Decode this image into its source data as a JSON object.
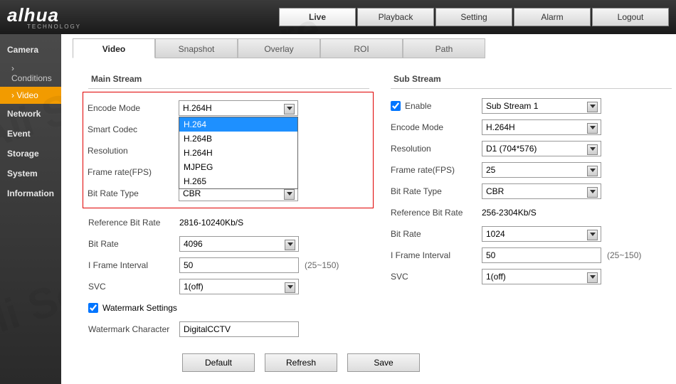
{
  "logo": "alhua",
  "logo_sub": "TECHNOLOGY",
  "topnav": {
    "live": "Live",
    "playback": "Playback",
    "setting": "Setting",
    "alarm": "Alarm",
    "logout": "Logout"
  },
  "sidebar": {
    "camera": "Camera",
    "conditions": "Conditions",
    "video": "Video",
    "network": "Network",
    "event": "Event",
    "storage": "Storage",
    "system": "System",
    "information": "Information"
  },
  "tabs": {
    "video": "Video",
    "snapshot": "Snapshot",
    "overlay": "Overlay",
    "roi": "ROI",
    "path": "Path"
  },
  "main": {
    "title": "Main Stream",
    "encode_mode_lbl": "Encode Mode",
    "encode_mode": "H.264H",
    "encode_options": [
      "H.264",
      "H.264B",
      "H.264H",
      "MJPEG",
      "H.265"
    ],
    "smart_codec_lbl": "Smart Codec",
    "resolution_lbl": "Resolution",
    "fps_lbl": "Frame rate(FPS)",
    "brt_lbl": "Bit Rate Type",
    "brt": "CBR",
    "ref_lbl": "Reference Bit Rate",
    "ref": "2816-10240Kb/S",
    "br_lbl": "Bit Rate",
    "br": "4096",
    "ifi_lbl": "I Frame Interval",
    "ifi": "50",
    "ifi_note": "(25~150)",
    "svc_lbl": "SVC",
    "svc": "1(off)",
    "wm_lbl": "Watermark Settings",
    "wmc_lbl": "Watermark Character",
    "wmc": "DigitalCCTV"
  },
  "sub": {
    "title": "Sub Stream",
    "enable_lbl": "Enable",
    "stream": "Sub Stream 1",
    "encode_mode_lbl": "Encode Mode",
    "encode_mode": "H.264H",
    "resolution_lbl": "Resolution",
    "resolution": "D1 (704*576)",
    "fps_lbl": "Frame rate(FPS)",
    "fps": "25",
    "brt_lbl": "Bit Rate Type",
    "brt": "CBR",
    "ref_lbl": "Reference Bit Rate",
    "ref": "256-2304Kb/S",
    "br_lbl": "Bit Rate",
    "br": "1024",
    "ifi_lbl": "I Frame Interval",
    "ifi": "50",
    "ifi_note": "(25~150)",
    "svc_lbl": "SVC",
    "svc": "1(off)"
  },
  "buttons": {
    "default": "Default",
    "refresh": "Refresh",
    "save": "Save"
  },
  "watermark_text": "Ali Security Store"
}
